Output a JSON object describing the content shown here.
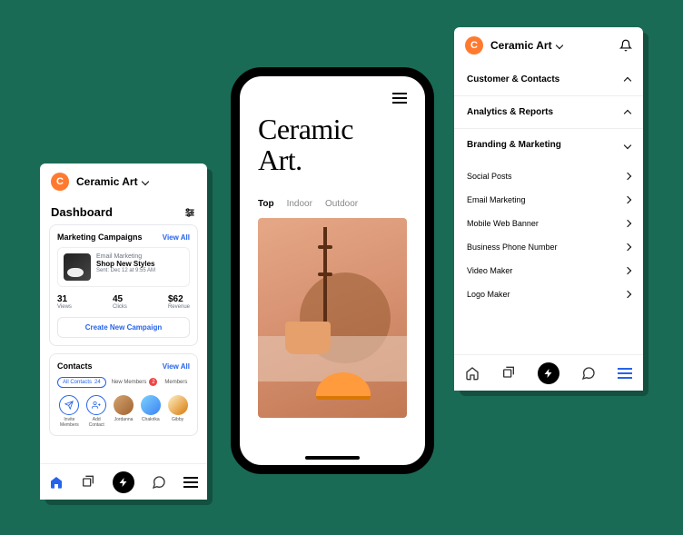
{
  "brand": {
    "initial": "C",
    "name": "Ceramic Art"
  },
  "left": {
    "dashboard_title": "Dashboard",
    "marketing": {
      "title": "Marketing Campaigns",
      "view_all": "View All",
      "campaign": {
        "type": "Email Marketing",
        "name": "Shop New Styles",
        "sent": "Sent: Dec 12 at 9:55 AM"
      },
      "stats": [
        {
          "value": "31",
          "label": "Views"
        },
        {
          "value": "45",
          "label": "Clicks"
        },
        {
          "value": "$62",
          "label": "Revenue"
        }
      ],
      "create_btn": "Create New Campaign"
    },
    "contacts": {
      "title": "Contacts",
      "view_all": "View All",
      "chips": {
        "all": "All Contacts",
        "all_count": "24",
        "new": "New Members",
        "new_count": "2",
        "members": "Members"
      },
      "people": [
        {
          "label": "Invite Members"
        },
        {
          "label": "Add Contact"
        },
        {
          "label": "Jordanna"
        },
        {
          "label": "Chakrika"
        },
        {
          "label": "Gibby"
        }
      ]
    }
  },
  "phone": {
    "title_line1": "Ceramic",
    "title_line2": "Art.",
    "tabs": [
      "Top",
      "Indoor",
      "Outdoor"
    ]
  },
  "right": {
    "sections": [
      {
        "label": "Customer & Contacts",
        "expanded": false
      },
      {
        "label": "Analytics & Reports",
        "expanded": false
      },
      {
        "label": "Branding & Marketing",
        "expanded": true
      }
    ],
    "menu": [
      "Social Posts",
      "Email Marketing",
      "Mobile Web Banner",
      "Business Phone Number",
      "Video Maker",
      "Logo Maker"
    ]
  }
}
